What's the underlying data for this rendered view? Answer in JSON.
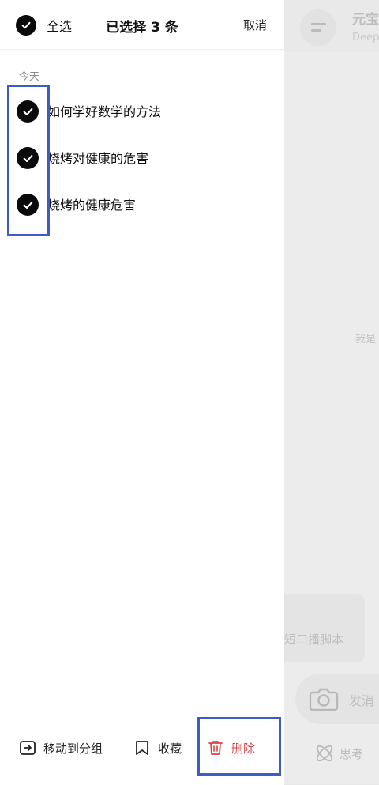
{
  "background_app": {
    "title": "元宝",
    "subtitle": "DeepS",
    "hint": "我是",
    "card_text": "短口播脚本",
    "input_placeholder": "发消",
    "think_label": "思考"
  },
  "topbar": {
    "select_all_label": "全选",
    "title": "已选择 3 条",
    "cancel_label": "取消"
  },
  "section": {
    "label": "今天"
  },
  "conversations": [
    {
      "text": "如何学好数学的方法",
      "checked": true
    },
    {
      "text": "烧烤对健康的危害",
      "checked": true
    },
    {
      "text": "烧烤的健康危害",
      "checked": true
    }
  ],
  "bottombar": {
    "move_label": "移动到分组",
    "favorite_label": "收藏",
    "delete_label": "删除"
  },
  "colors": {
    "check_fill": "#0a0a0a",
    "delete_red": "#d84444",
    "highlight_blue": "#3f5cc6"
  }
}
